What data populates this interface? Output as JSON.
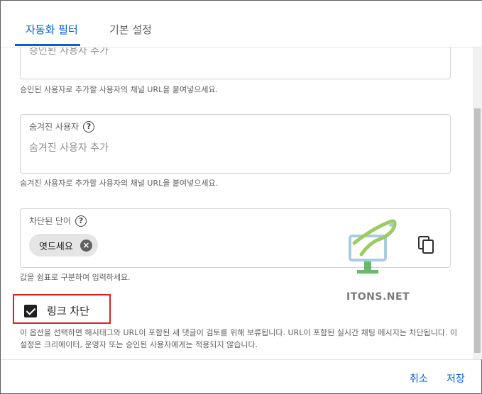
{
  "tabs": [
    {
      "label": "자동화 필터",
      "active": true
    },
    {
      "label": "기본 설정",
      "active": false
    }
  ],
  "approved_users": {
    "placeholder": "승인된 사용자 추가",
    "helper": "승인된 사용자로 추가할 사용자의 채널 URL을 붙여넣으세요."
  },
  "hidden_users": {
    "label": "숨겨진 사용자",
    "placeholder": "숨겨진 사용자 추가",
    "helper": "숨겨진 사용자로 추가할 사용자의 채널 URL을 붙여넣으세요."
  },
  "blocked_words": {
    "label": "차단된 단어",
    "chips": [
      "엿드세요"
    ],
    "helper": "값을 쉼표로 구분하여 입력하세요."
  },
  "link_blocking": {
    "label": "링크 차단",
    "checked": true,
    "description": "이 옵션을 선택하면 해시태그와 URL이 포함된 새 댓글이 검토를 위해 보류됩니다. URL이 포함된 실시간 채팅 메시지는 차단됩니다. 이 설정은 크리에이터, 운영자 또는 승인된 사용자에게는 적용되지 않습니다."
  },
  "watermark": {
    "text": "ITONS.NET"
  },
  "footer": {
    "cancel_label": "취소",
    "save_label": "저장"
  },
  "colors": {
    "accent": "#065fd4",
    "highlight": "#e02020",
    "checkbox": "#202020"
  },
  "icons": {
    "help": "help-circle-icon",
    "chip_remove": "close-circle-icon",
    "copy": "copy-icon"
  }
}
